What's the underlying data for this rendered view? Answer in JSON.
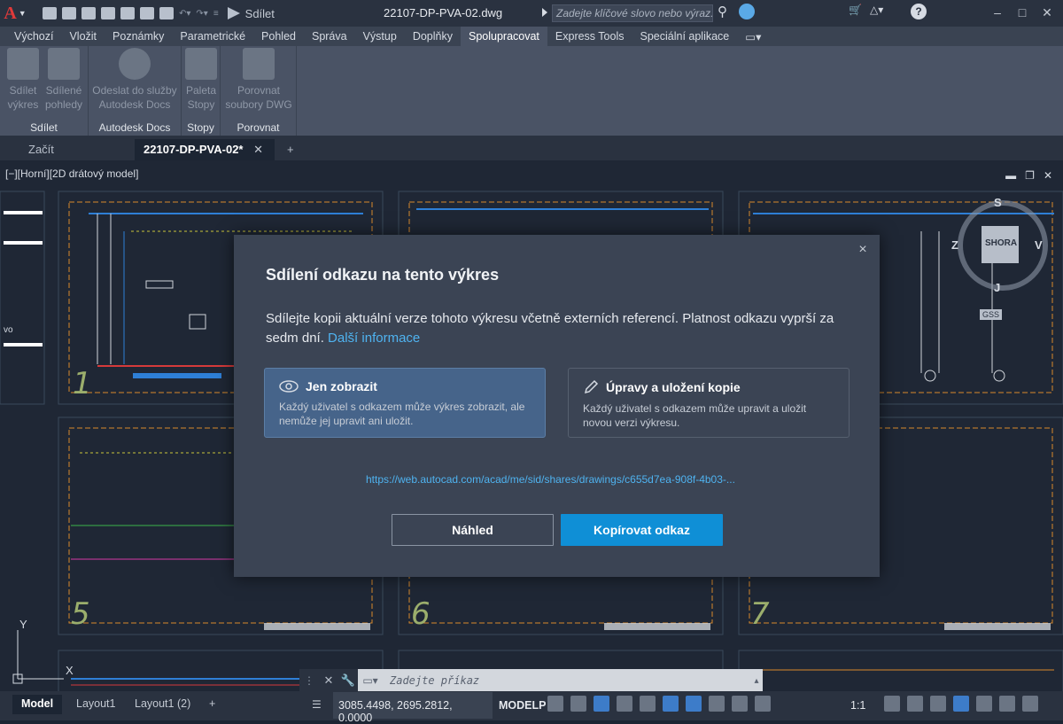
{
  "app": {
    "logo": "A",
    "share_label": "Sdílet",
    "doc_title": "22107-DP-PVA-02.dwg",
    "search_placeholder": "Zadejte klíčové slovo nebo výraz."
  },
  "menu": {
    "tabs": [
      "Výchozí",
      "Vložit",
      "Poznámky",
      "Parametrické",
      "Pohled",
      "Správa",
      "Výstup",
      "Doplňky",
      "Spolupracovat",
      "Express Tools",
      "Speciální aplikace"
    ],
    "active": "Spolupracovat"
  },
  "ribbon": {
    "panels": [
      {
        "title": "Sdílet",
        "buttons": [
          {
            "label": "Sdílet výkres"
          },
          {
            "label": "Sdílené pohledy"
          }
        ]
      },
      {
        "title": "Autodesk Docs",
        "buttons": [
          {
            "label": "Odeslat do služby Autodesk Docs"
          }
        ]
      },
      {
        "title": "Stopy",
        "buttons": [
          {
            "label": "Paleta Stopy"
          }
        ]
      },
      {
        "title": "Porovnat",
        "buttons": [
          {
            "label": "Porovnat soubory DWG"
          }
        ]
      }
    ]
  },
  "doc_tabs": {
    "start": "Začít",
    "active": "22107-DP-PVA-02*",
    "add": "+"
  },
  "viewport": {
    "label": "[−][Horní][2D drátový model]",
    "viewcube": {
      "top": "SHORA",
      "n": "S",
      "s": "J",
      "e": "V",
      "w": "Z",
      "ucs": "GSS"
    },
    "sheet_numbers": [
      "1",
      "5",
      "6",
      "7"
    ],
    "side_text": "vo"
  },
  "dialog": {
    "title": "Sdílení odkazu na tento výkres",
    "description": "Sdílejte kopii aktuální verze tohoto výkresu včetně externích referencí. Platnost odkazu vyprší za sedm dní.",
    "more_info": "Další informace",
    "options": [
      {
        "title": "Jen zobrazit",
        "description": "Každý uživatel s odkazem může výkres zobrazit, ale nemůže jej upravit ani uložit.",
        "selected": true
      },
      {
        "title": "Úpravy a uložení kopie",
        "description": "Každý uživatel s odkazem může upravit a uložit novou verzi výkresu.",
        "selected": false
      }
    ],
    "url": "https://web.autocad.com/acad/me/sid/shares/drawings/c655d7ea-908f-4b03-...",
    "preview_button": "Náhled",
    "copy_button": "Kopírovat odkaz",
    "close": "×"
  },
  "command_line": {
    "placeholder": "Zadejte příkaz"
  },
  "status": {
    "layout_tabs": [
      "Model",
      "Layout1",
      "Layout1 (2)"
    ],
    "active_layout": "Model",
    "coordinates": "3085.4498, 2695.2812, 0.0000",
    "mode": "MODELP",
    "scale": "1:1",
    "axis_y": "Y",
    "axis_x": "X"
  }
}
